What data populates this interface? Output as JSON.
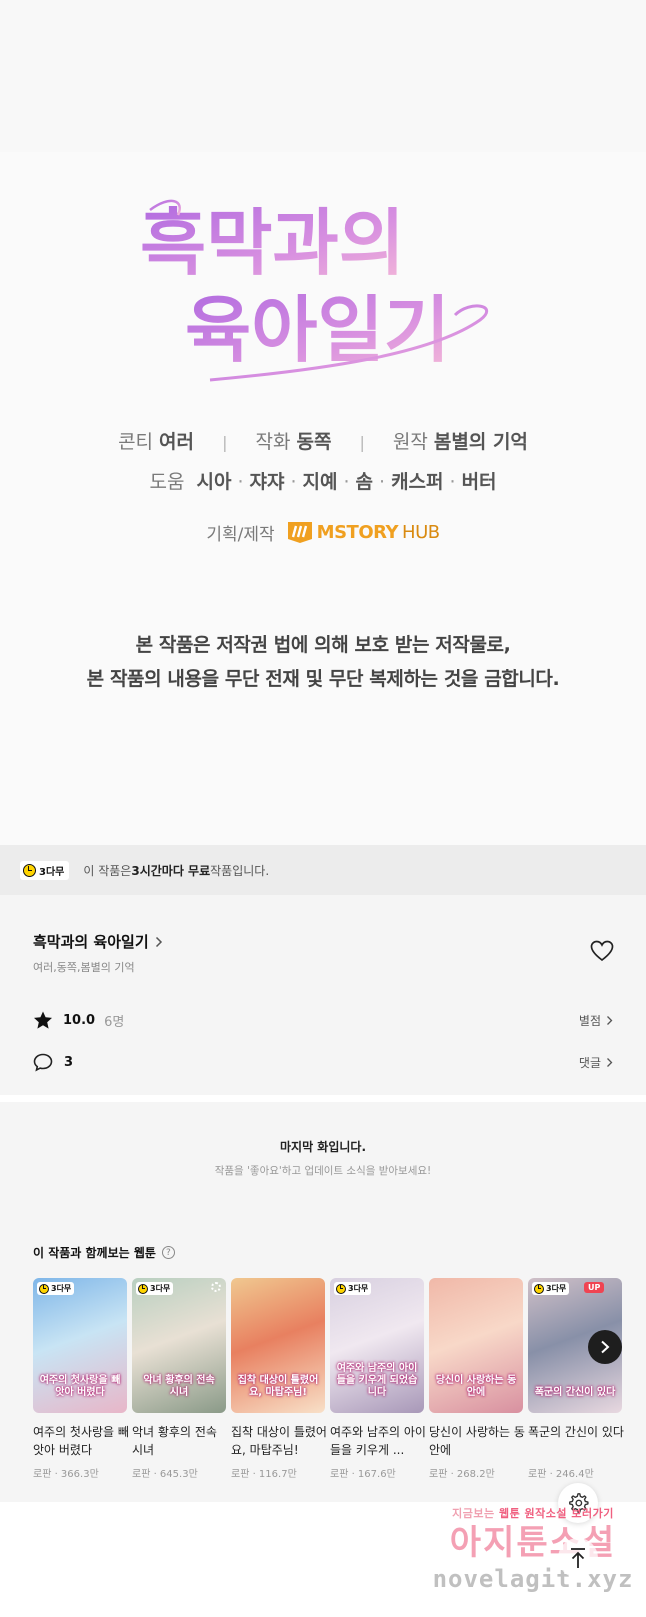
{
  "comic": {
    "logo_line1": "흑막과의",
    "logo_line2": "육아일기",
    "credits": {
      "conti_label": "콘티",
      "conti_value": "여러",
      "art_label": "작화",
      "art_value": "동쪽",
      "original_label": "원작",
      "original_value": "봄별의 기억",
      "assist_label": "도움",
      "assistants": [
        "시아",
        "쟈쟈",
        "지예",
        "솜",
        "캐스퍼",
        "버터"
      ]
    },
    "producer_label": "기획/제작",
    "producer_logo_a": "MSTORY",
    "producer_logo_b": "HUB",
    "notice_line1": "본 작품은 저작권 법에 의해 보호 받는 저작물로,",
    "notice_line2": "본 작품의 내용을 무단 전재 및 무단 복제하는 것을 금합니다."
  },
  "free_banner": {
    "badge": "3다무",
    "text_pre": "이 작품은 ",
    "text_bold": "3시간마다 무료",
    "text_post": " 작품입니다."
  },
  "info": {
    "title": "흑막과의 육아일기",
    "authors": "여러,동쪽,봄별의 기억",
    "rating": "10.0",
    "rating_count": "6명",
    "rating_link": "별점",
    "comments": "3",
    "comments_link": "댓글"
  },
  "last_episode": {
    "title": "마지막 화입니다.",
    "subtitle": "작품을 '좋아요'하고 업데이트 소식을 받아보세요!"
  },
  "reco": {
    "heading": "이 작품과 함께보는 웹툰",
    "help": "?",
    "items": [
      {
        "thumb_text": "여주의 첫사랑을 빼앗아 버렸다",
        "name": "여주의 첫사랑을 빼앗아 버렸다",
        "meta": "로판 · 366.3만",
        "badge": "3다무",
        "up": "",
        "colors": [
          "#7fb6e8",
          "#c8e4f4",
          "#e8b6c8"
        ]
      },
      {
        "thumb_text": "악녀 황후의 전속 시녀",
        "name": "악녀 황후의 전속 시녀",
        "meta": "로판 · 645.3만",
        "badge": "3다무",
        "up": "",
        "colors": [
          "#b8cfc0",
          "#e8e0d4",
          "#8a9a88"
        ]
      },
      {
        "thumb_text": "집착 대상이 틀렸어요, 마탑주님!",
        "name": "집착 대상이 틀렸어요, 마탑주님!",
        "meta": "로판 · 116.7만",
        "badge": "",
        "up": "",
        "colors": [
          "#f0c890",
          "#e88060",
          "#f8e0c8"
        ]
      },
      {
        "thumb_text": "여주와 남주의 아이들을 키우게 되었습니다",
        "name": "여주와 남주의 아이들을 키우게 ...",
        "meta": "로판 · 167.6만",
        "badge": "3다무",
        "up": "",
        "colors": [
          "#d8d0e0",
          "#f0e8f0",
          "#a898b8"
        ]
      },
      {
        "thumb_text": "당신이 사랑하는 동안에",
        "name": "당신이 사랑하는 동안에",
        "meta": "로판 · 268.2만",
        "badge": "",
        "up": "",
        "colors": [
          "#f0b8a8",
          "#f8d8c8",
          "#d890a0"
        ]
      },
      {
        "thumb_text": "폭군의 간신이 있다",
        "name": "폭군의 간신이 있다",
        "meta": "로판 · 246.4만",
        "badge": "3다무",
        "up": "UP",
        "colors": [
          "#d0c0c8",
          "#8890a8",
          "#e8d8e0"
        ]
      }
    ]
  },
  "watermark": {
    "top_a": "지금보는 ",
    "top_b": "웹툰",
    "top_c": " 원작소설 ",
    "top_d": "보러가기",
    "middle": "아지툰소설",
    "bottom": "novelagit.xyz"
  },
  "colors": {
    "logo_gradient": [
      "#b880e0",
      "#f0a0d0"
    ],
    "producer": "#f0a020",
    "free_badge": "#ffd400",
    "up_badge": "#f04452"
  },
  "icons": [
    "clock-icon",
    "chevron-right-icon",
    "heart-icon",
    "star-icon",
    "comment-icon",
    "help-icon",
    "arrow-right-icon",
    "gear-icon",
    "arrow-up-icon"
  ]
}
